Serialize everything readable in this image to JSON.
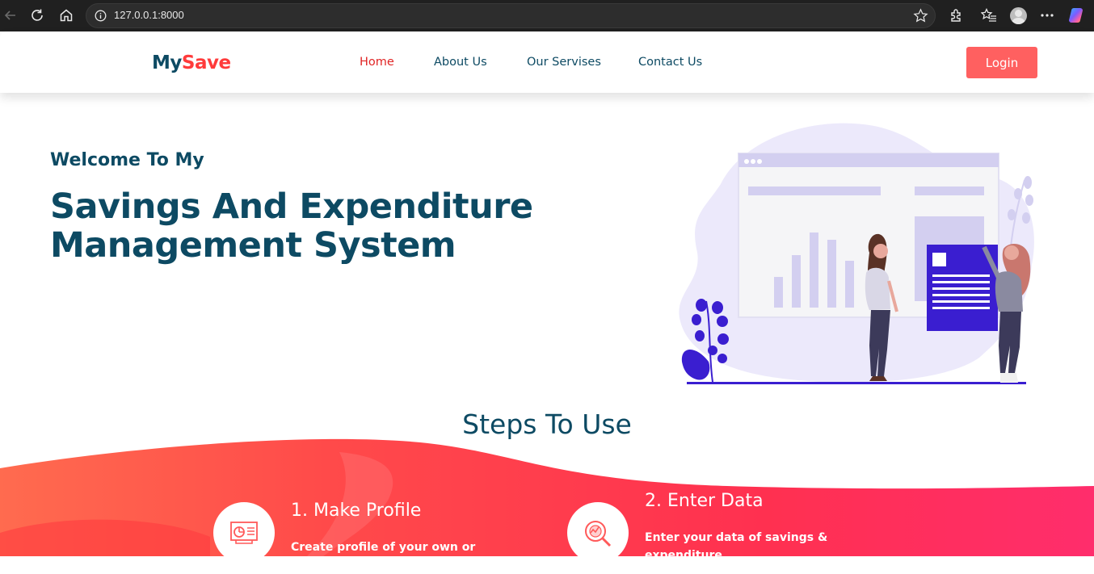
{
  "browser": {
    "url": "127.0.0.1:8000",
    "icons": [
      "back-icon",
      "reload-icon",
      "home-icon",
      "info-icon",
      "favorite-star-icon",
      "extensions-icon",
      "favorites-icon",
      "profile-avatar",
      "more-icon",
      "copilot-icon"
    ]
  },
  "header": {
    "logo_part1": "My",
    "logo_part2": "Save",
    "nav": [
      "Home",
      "About Us",
      "Our Servises",
      "Contact Us"
    ],
    "login": "Login"
  },
  "hero": {
    "subtitle": "Welcome To My",
    "title_line1": "Savings And Expenditure",
    "title_line2": "Management System"
  },
  "steps": {
    "title": "Steps To Use",
    "items": [
      {
        "title": "1. Make Profile",
        "desc": "Create profile of your own or shop"
      },
      {
        "title": "2. Enter Data",
        "desc": "Enter your data of savings & expenditure"
      }
    ]
  },
  "colors": {
    "primary": "#0d4a63",
    "accent": "#ff3b3b",
    "button": "#ff6060",
    "illustration": "#3a1ed0"
  }
}
